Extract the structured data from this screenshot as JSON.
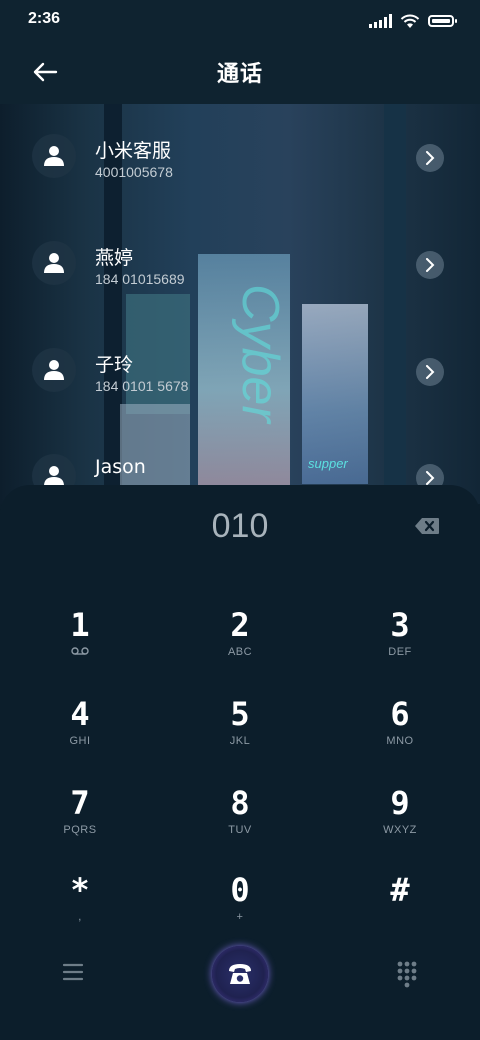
{
  "status_bar": {
    "time": "2:36"
  },
  "header": {
    "title": "通话"
  },
  "contacts": [
    {
      "name": "小米客服",
      "number": "4001005678"
    },
    {
      "name": "燕婷",
      "number": "184 01015689"
    },
    {
      "name": "子玲",
      "number": "184 0101 5678"
    },
    {
      "name": "Jason",
      "number": ""
    }
  ],
  "background_text": {
    "sign_main": "Cyber",
    "sign_small": "supper"
  },
  "dialpad": {
    "display": "010",
    "keys": [
      {
        "digit": "1",
        "letters": ""
      },
      {
        "digit": "2",
        "letters": "ABC"
      },
      {
        "digit": "3",
        "letters": "DEF"
      },
      {
        "digit": "4",
        "letters": "GHI"
      },
      {
        "digit": "5",
        "letters": "JKL"
      },
      {
        "digit": "6",
        "letters": "MNO"
      },
      {
        "digit": "7",
        "letters": "PQRS"
      },
      {
        "digit": "8",
        "letters": "TUV"
      },
      {
        "digit": "9",
        "letters": "WXYZ"
      },
      {
        "digit": "*",
        "letters": ","
      },
      {
        "digit": "0",
        "letters": "+"
      },
      {
        "digit": "#",
        "letters": ""
      }
    ]
  },
  "icons": {
    "back": "back-arrow-icon",
    "avatar": "person-icon",
    "chevron": "chevron-right-icon",
    "voicemail": "voicemail-icon",
    "delete": "backspace-icon",
    "menu": "menu-icon",
    "call": "phone-call-icon",
    "keypad": "keypad-grid-icon"
  },
  "colors": {
    "background": "#0c1e2b",
    "call_accent": "#7a68d8"
  }
}
